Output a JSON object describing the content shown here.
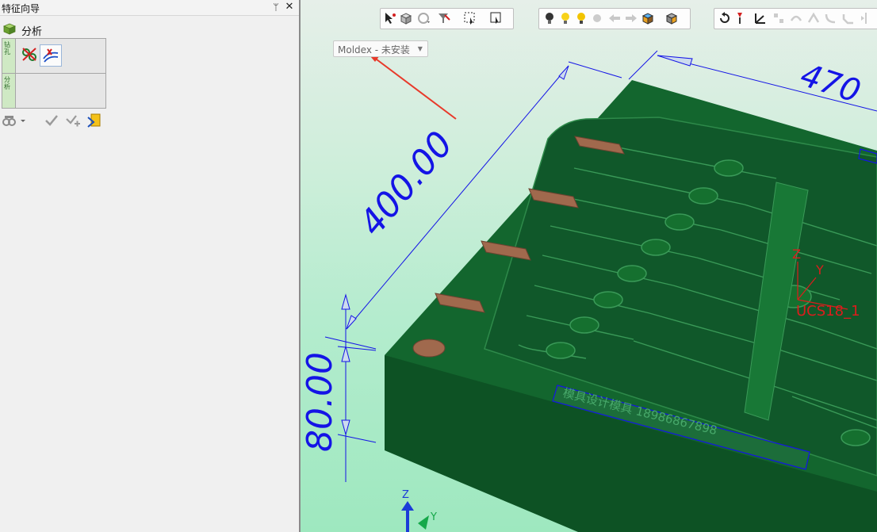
{
  "panel": {
    "title": "特征向导",
    "pin_glyph": "ᛘ",
    "close_glyph": "✕"
  },
  "analysis": {
    "label": "分析",
    "icon": "analysis-cube-icon"
  },
  "wizard": {
    "tabs": [
      {
        "label": "钻孔",
        "icon": "vertical-tab"
      },
      {
        "label": "分析",
        "icon": "vertical-tab"
      }
    ],
    "tools": [
      "drill-analyze-icon",
      "hole-feature-icon"
    ]
  },
  "panel_actions": [
    "link-icon",
    "dropdown-arrow-icon",
    "check-icon",
    "check-plus-icon",
    "export-icon"
  ],
  "viewport": {
    "moldex_label": "Moldex - 未安装",
    "dim_400": "400.00",
    "dim_80": "80.00",
    "dim_470": "470",
    "ucs_label": "UCS18_1",
    "z_label": "Z",
    "y_label": "Y",
    "triad_z": "Z",
    "triad_y": "Y",
    "engraving": "模具设计模具 18986867898"
  },
  "colors": {
    "mold_top": "#13662e",
    "mold_side": "#0b4a20",
    "dimension": "#1414e6",
    "arrow": "#e8392a",
    "ucs": "#dd1c1c",
    "pad": "#a0694d"
  }
}
